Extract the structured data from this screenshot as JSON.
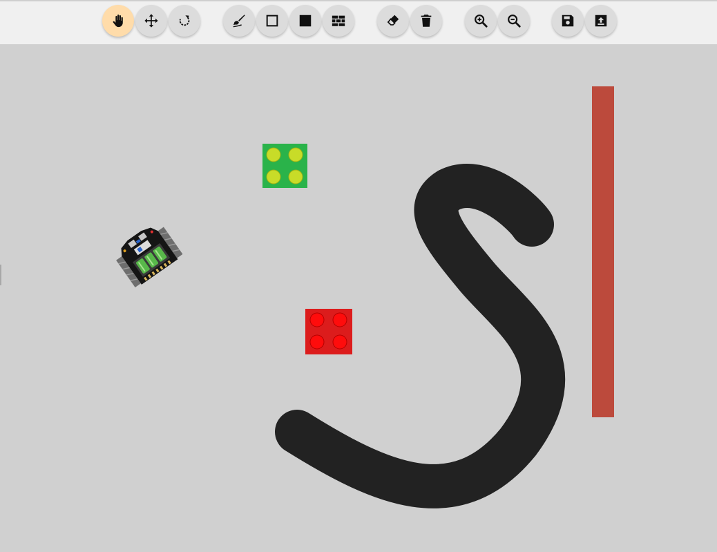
{
  "app": {
    "toolbar": {
      "groups": [
        {
          "name": "navigation",
          "tools": [
            {
              "id": "pan",
              "icon": "hand-icon",
              "active": true
            },
            {
              "id": "move",
              "icon": "move-arrows-icon",
              "active": false
            },
            {
              "id": "rotate",
              "icon": "rotate-icon",
              "active": false
            }
          ]
        },
        {
          "name": "drawing",
          "tools": [
            {
              "id": "draw-line",
              "icon": "brush-icon",
              "active": false
            },
            {
              "id": "outline-rect",
              "icon": "square-outline-icon",
              "active": false
            },
            {
              "id": "filled-rect",
              "icon": "square-filled-icon",
              "active": false
            },
            {
              "id": "bricks",
              "icon": "bricks-icon",
              "active": false
            }
          ]
        },
        {
          "name": "edit",
          "tools": [
            {
              "id": "erase",
              "icon": "eraser-icon",
              "active": false
            },
            {
              "id": "clear",
              "icon": "trash-icon",
              "active": false
            }
          ]
        },
        {
          "name": "zoom",
          "tools": [
            {
              "id": "zoom-in",
              "icon": "zoom-in-icon",
              "active": false
            },
            {
              "id": "zoom-out",
              "icon": "zoom-out-icon",
              "active": false
            }
          ]
        },
        {
          "name": "file",
          "tools": [
            {
              "id": "save",
              "icon": "save-icon",
              "active": false
            },
            {
              "id": "load",
              "icon": "upload-icon",
              "active": false
            }
          ]
        }
      ]
    },
    "canvas": {
      "background": "#d0d0d0",
      "objects": [
        {
          "id": "green-brick",
          "type": "brick",
          "studs": 4,
          "color": "#2ab34a",
          "stud_color": "#c8dc28"
        },
        {
          "id": "red-brick",
          "type": "brick",
          "studs": 4,
          "color": "#dc1c1c",
          "stud_color": "#ff0c0c"
        },
        {
          "id": "black-s-track",
          "type": "line",
          "color": "#222222"
        },
        {
          "id": "red-wall",
          "type": "wall",
          "color": "#bc4a3c"
        },
        {
          "id": "robot",
          "type": "robot"
        }
      ]
    },
    "colors": {
      "toolbar_bg": "#f0f0f0",
      "button_bg": "#dcdcdc",
      "active_button_bg": "#ffdcaa",
      "icon": "#111111"
    }
  }
}
